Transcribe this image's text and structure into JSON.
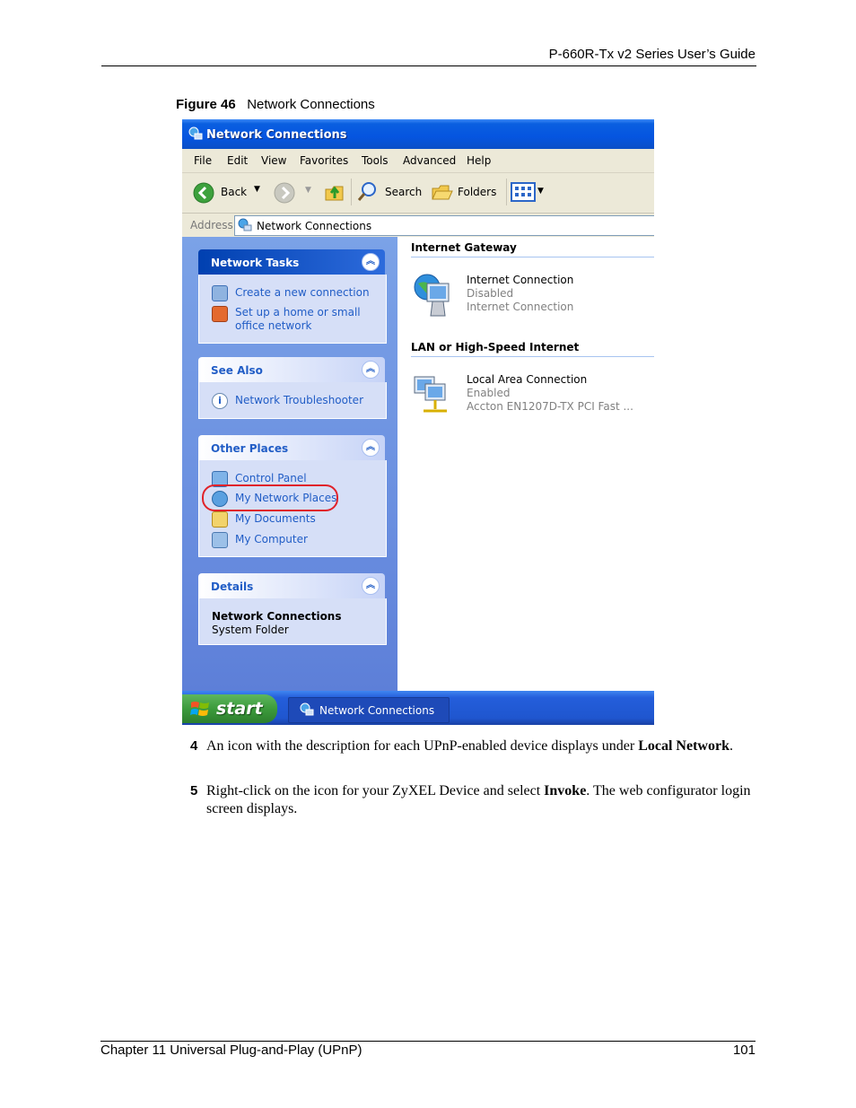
{
  "header": {
    "title": "P-660R-Tx v2 Series User’s Guide"
  },
  "figure": {
    "label": "Figure 46",
    "title": "Network Connections"
  },
  "window": {
    "title": "Network Connections",
    "menu": [
      "File",
      "Edit",
      "View",
      "Favorites",
      "Tools",
      "Advanced",
      "Help"
    ],
    "toolbar": {
      "back": "Back",
      "search": "Search",
      "folders": "Folders"
    },
    "address": {
      "label": "Address",
      "value": "Network Connections"
    },
    "panels": {
      "network_tasks": {
        "title": "Network Tasks",
        "items": [
          "Create a new connection",
          "Set up a home or small",
          "office network"
        ]
      },
      "see_also": {
        "title": "See Also",
        "items": [
          "Network Troubleshooter"
        ]
      },
      "other_places": {
        "title": "Other Places",
        "items": [
          "Control Panel",
          "My Network Places",
          "My Documents",
          "My Computer"
        ]
      },
      "details": {
        "title": "Details",
        "name": "Network Connections",
        "type": "System Folder"
      }
    },
    "content": {
      "internet_gateway": {
        "title": "Internet Gateway",
        "item": {
          "name": "Internet Connection",
          "status": "Disabled",
          "type": "Internet Connection"
        }
      },
      "lan": {
        "title": "LAN or High-Speed Internet",
        "item": {
          "name": "Local Area Connection",
          "status": "Enabled",
          "device": "Accton EN1207D-TX PCI Fast ..."
        }
      }
    },
    "taskbar": {
      "start": "start",
      "task": "Network Connections"
    }
  },
  "steps": [
    {
      "num": "4",
      "text_a": "An icon with the description for each UPnP-enabled device displays under ",
      "bold": "Local Network",
      "text_b": "."
    },
    {
      "num": "5",
      "text_a": "Right-click on the icon for your ZyXEL Device and select ",
      "bold": "Invoke",
      "text_b": ". The web configurator login screen displays."
    }
  ],
  "footer": {
    "chapter": "Chapter 11 Universal Plug-and-Play (UPnP)",
    "page": "101"
  },
  "colors": {
    "xp_blue": "#0555e0",
    "task_link": "#215dc6",
    "highlight": "#e0222a"
  }
}
